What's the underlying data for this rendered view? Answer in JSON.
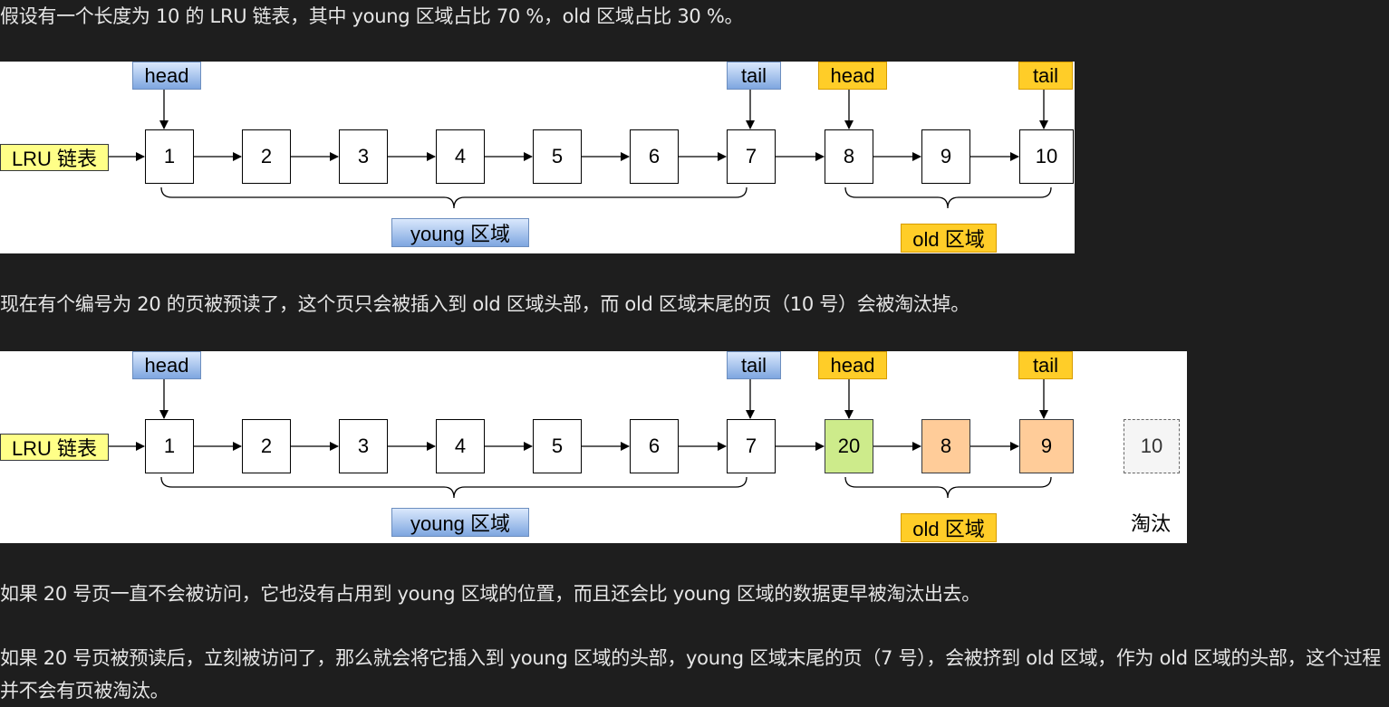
{
  "paragraphs": {
    "intro": "假设有一个长度为 10 的 LRU 链表，其中 young 区域占比 70 %，old 区域占比 30 %。",
    "preread": "现在有个编号为 20 的页被预读了，这个页只会被插入到  old 区域头部，而 old 区域末尾的页（10 号）会被淘汰掉。",
    "not_accessed": "如果 20 号页一直不会被访问，它也没有占用到 young 区域的位置，而且还会比 young 区域的数据更早被淘汰出去。",
    "accessed": "如果 20 号页被预读后，立刻被访问了，那么就会将它插入到 young 区域的头部，young 区域末尾的页（7 号），会被挤到 old 区域，作为 old 区域的头部，这个过程并不会有页被淘汰。"
  },
  "labels": {
    "head": "head",
    "tail": "tail",
    "lru_list": "LRU 链表",
    "young_region": "young 区域",
    "old_region": "old 区域",
    "evicted": "淘汰"
  },
  "diagram1": {
    "nodes": [
      "1",
      "2",
      "3",
      "4",
      "5",
      "6",
      "7",
      "8",
      "9",
      "10"
    ]
  },
  "diagram2": {
    "nodes": [
      "1",
      "2",
      "3",
      "4",
      "5",
      "6",
      "7",
      "20",
      "8",
      "9"
    ],
    "evicted_node": "10"
  },
  "colors": {
    "page_background": "#1e1e1e",
    "young_tag": "#7ea6e0",
    "old_tag": "#ffcd28",
    "lru_tag": "#ffff88",
    "new_page": "#cdeb8b",
    "shifted_page": "#ffcc99"
  }
}
